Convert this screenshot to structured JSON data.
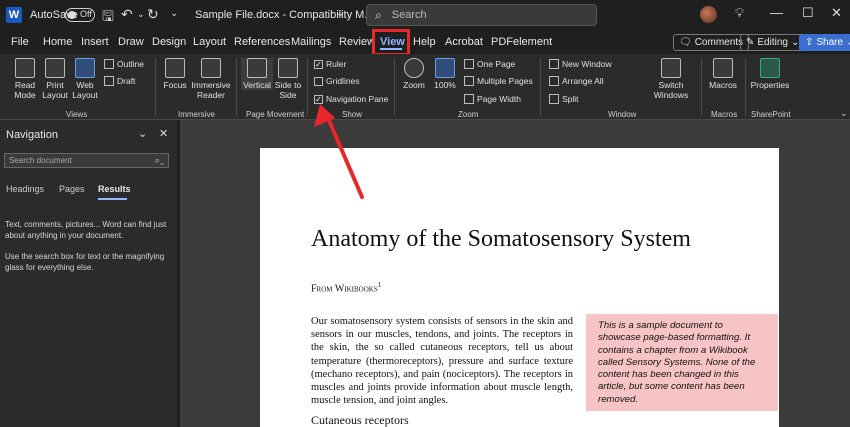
{
  "titlebar": {
    "autosave_label": "AutoSave",
    "autosave_state": "Off",
    "doc_title": "Sample File.docx - Compatibility M...",
    "search_placeholder": "Search",
    "controls": {
      "minimize": "—",
      "restore": "☐",
      "close": "✕"
    }
  },
  "menu": {
    "tabs": [
      "File",
      "Home",
      "Insert",
      "Draw",
      "Design",
      "Layout",
      "References",
      "Mailings",
      "Review",
      "View",
      "Help",
      "Acrobat",
      "PDFelement"
    ],
    "active_tab": "View",
    "comments_label": "Comments",
    "editing_label": "Editing",
    "share_label": "Share"
  },
  "ribbon": {
    "views": {
      "label": "Views",
      "read_mode": "Read Mode",
      "print_layout": "Print Layout",
      "web_layout": "Web Layout",
      "outline": "Outline",
      "draft": "Draft"
    },
    "immersive": {
      "label": "Immersive",
      "focus": "Focus",
      "immersive_reader": "Immersive Reader"
    },
    "page_movement": {
      "label": "Page Movement",
      "vertical": "Vertical",
      "side_to_side": "Side to Side"
    },
    "show": {
      "label": "Show",
      "ruler": "Ruler",
      "gridlines": "Gridlines",
      "navigation_pane": "Navigation Pane"
    },
    "zoom": {
      "label": "Zoom",
      "zoom": "Zoom",
      "hundred": "100%",
      "one_page": "One Page",
      "multiple_pages": "Multiple Pages",
      "page_width": "Page Width"
    },
    "window": {
      "label": "Window",
      "new_window": "New Window",
      "arrange_all": "Arrange All",
      "split": "Split",
      "switch_windows": "Switch Windows"
    },
    "macros": {
      "label": "Macros",
      "macros": "Macros"
    },
    "sharepoint": {
      "label": "SharePoint",
      "properties": "Properties"
    }
  },
  "nav": {
    "title": "Navigation",
    "search_placeholder": "Search document",
    "tabs": [
      "Headings",
      "Pages",
      "Results"
    ],
    "active_tab": "Results",
    "text1": "Text, comments, pictures... Word can find just about anything in your document.",
    "text2": "Use the search box for text or the magnifying glass for everything else."
  },
  "document": {
    "heading": "Anatomy of the Somatosensory System",
    "from": "From Wikibooks",
    "footnote": "1",
    "paragraph": "Our somatosensory system consists of sensors in the skin and sensors in our muscles, tendons, and joints. The receptors in the skin, the so called cutaneous receptors, tell us about temperature (thermoreceptors), pressure and surface texture (mechano receptors), and pain (nociceptors). The receptors in muscles and joints provide information about muscle length, muscle tension, and joint angles.",
    "sidebox": "This is a sample document to showcase page-based formatting. It contains a chapter from a Wikibook called Sensory Systems. None of the content has been changed in this article, but some content has been removed.",
    "subheading": "Cutaneous receptors"
  },
  "colors": {
    "accent": "#8fb8ff",
    "highlight": "#e8262b",
    "sidebox": "#f6c4c4",
    "share": "#3a6fd1"
  }
}
